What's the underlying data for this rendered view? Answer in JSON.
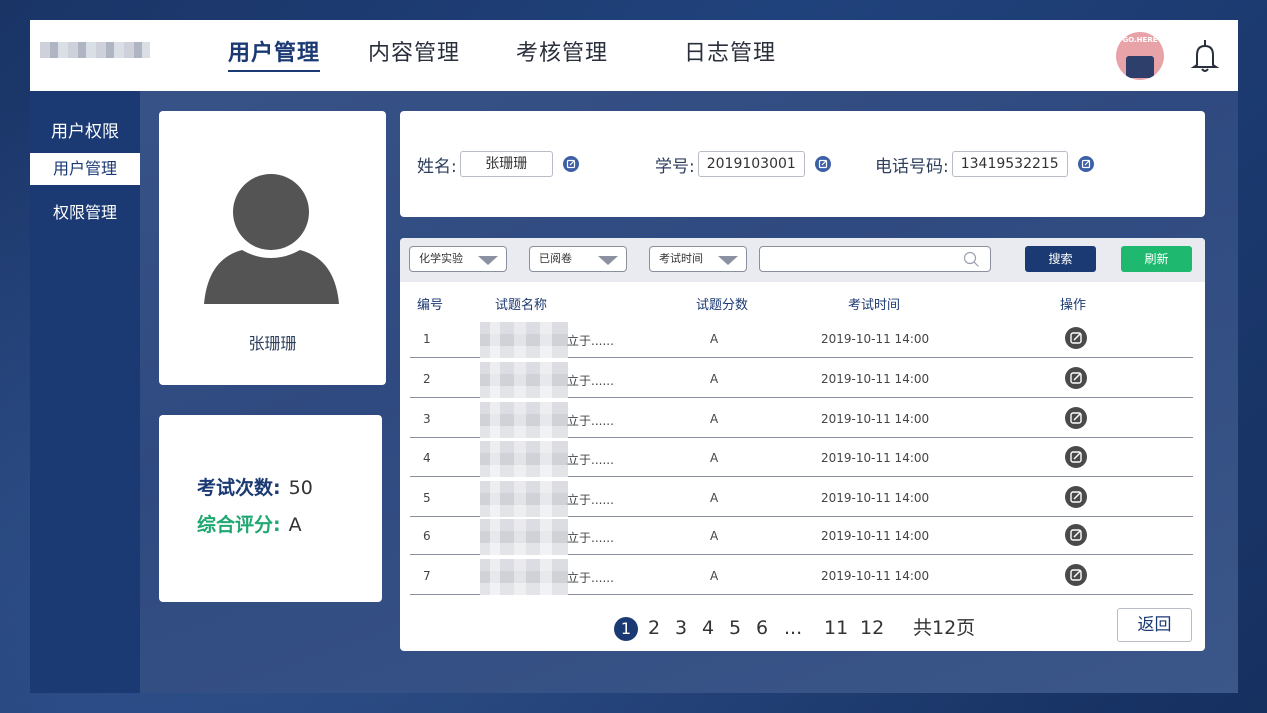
{
  "header": {
    "nav": [
      {
        "label": "用户管理",
        "active": true
      },
      {
        "label": "内容管理",
        "active": false
      },
      {
        "label": "考核管理",
        "active": false
      },
      {
        "label": "日志管理",
        "active": false
      }
    ],
    "avatar_text": "GO.HERE"
  },
  "sidebar": {
    "heading": "用户权限",
    "items": [
      {
        "label": "用户管理",
        "active": true
      },
      {
        "label": "权限管理",
        "active": false
      }
    ]
  },
  "profile": {
    "name": "张珊珊"
  },
  "stats": {
    "exam_count_label": "考试次数:",
    "exam_count": "50",
    "score_label": "综合评分:",
    "score": "A"
  },
  "info": {
    "name_label": "姓名:",
    "name_value": "张珊珊",
    "id_label": "学号:",
    "id_value": "2019103001",
    "phone_label": "电话号码:",
    "phone_value": "13419532215"
  },
  "toolbar": {
    "filter_subject": "化学实验",
    "filter_status": "已阅卷",
    "filter_time": "考试时间",
    "search_placeholder": "",
    "search_label": "搜索",
    "refresh_label": "刷新"
  },
  "table": {
    "headers": [
      "编号",
      "试题名称",
      "试题分数",
      "考试时间",
      "操作"
    ],
    "rows": [
      {
        "id": "1",
        "name": "立于......",
        "score": "A",
        "time": "2019-10-11 14:00"
      },
      {
        "id": "2",
        "name": "立于......",
        "score": "A",
        "time": "2019-10-11 14:00"
      },
      {
        "id": "3",
        "name": "立于......",
        "score": "A",
        "time": "2019-10-11 14:00"
      },
      {
        "id": "4",
        "name": "立于......",
        "score": "A",
        "time": "2019-10-11 14:00"
      },
      {
        "id": "5",
        "name": "立于......",
        "score": "A",
        "time": "2019-10-11 14:00"
      },
      {
        "id": "6",
        "name": "立于......",
        "score": "A",
        "time": "2019-10-11 14:00"
      },
      {
        "id": "7",
        "name": "立于......",
        "score": "A",
        "time": "2019-10-11 14:00"
      }
    ]
  },
  "pagination": {
    "current": "1",
    "pages": [
      "2",
      "3",
      "4",
      "5",
      "6",
      "...",
      "11",
      "12"
    ],
    "total": "共12页",
    "back_label": "返回"
  },
  "colors": {
    "primary": "#1b3a73",
    "accent_green": "#1fb86f",
    "avatar_pink": "#e8a3a9"
  }
}
